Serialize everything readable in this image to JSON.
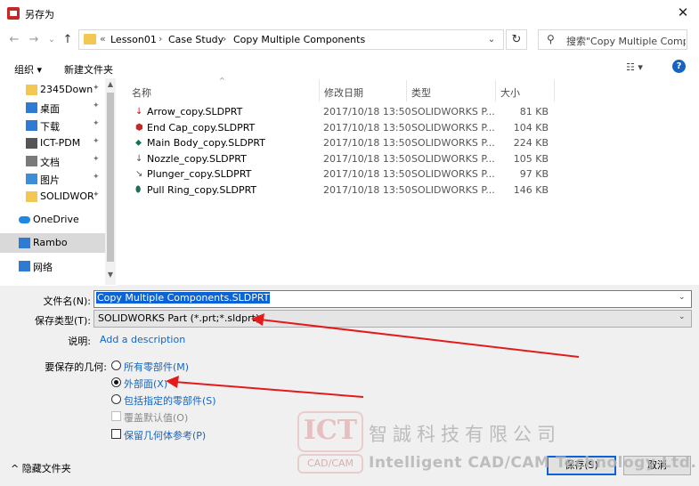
{
  "window": {
    "title": "另存为",
    "close": "✕"
  },
  "nav": {
    "back": "←",
    "forward": "→",
    "recent": "⌄",
    "up": "↑"
  },
  "address": {
    "overflow": "«",
    "crumbs": [
      "Lesson01",
      "Case Study",
      "Copy Multiple Components"
    ],
    "sep": "›",
    "dropdown": "⌄",
    "refresh": "↻"
  },
  "search": {
    "placeholder": "搜索\"Copy Multiple Comp..."
  },
  "toolbar": {
    "organize": "组织 ▾",
    "new_folder": "新建文件夹",
    "view": "☷ ▾",
    "help": "?"
  },
  "sidebar": {
    "items": [
      {
        "label": "2345Downlc",
        "icon": "folder-icon",
        "pinned": true
      },
      {
        "label": "桌面",
        "icon": "desktop-icon",
        "pinned": true
      },
      {
        "label": "下载",
        "icon": "download-icon",
        "pinned": true
      },
      {
        "label": "ICT-PDM",
        "icon": "network-drive-icon",
        "pinned": true
      },
      {
        "label": "文档",
        "icon": "document-icon",
        "pinned": true
      },
      {
        "label": "图片",
        "icon": "picture-icon",
        "pinned": true
      },
      {
        "label": "SOLIDWORI",
        "icon": "folder-icon",
        "pinned": true
      },
      {
        "label": "OneDrive",
        "icon": "cloud-icon",
        "pinned": false
      },
      {
        "label": "Rambo",
        "icon": "computer-icon",
        "pinned": false,
        "selected": true
      },
      {
        "label": "网络",
        "icon": "network-icon",
        "pinned": false
      }
    ],
    "pin_glyph": "📌"
  },
  "columns": {
    "name": "名称",
    "date": "修改日期",
    "type": "类型",
    "size": "大小",
    "sort": "^"
  },
  "files": [
    {
      "name": "Arrow_copy.SLDPRT",
      "date": "2017/10/18 13:50",
      "type": "SOLIDWORKS P...",
      "size": "81 KB",
      "icon": "↓",
      "color": "#b71c1c"
    },
    {
      "name": "End Cap_copy.SLDPRT",
      "date": "2017/10/18 13:50",
      "type": "SOLIDWORKS P...",
      "size": "104 KB",
      "icon": "⬢",
      "color": "#c62828"
    },
    {
      "name": "Main Body_copy.SLDPRT",
      "date": "2017/10/18 13:50",
      "type": "SOLIDWORKS P...",
      "size": "224 KB",
      "icon": "⬥",
      "color": "#1b6e5a"
    },
    {
      "name": "Nozzle_copy.SLDPRT",
      "date": "2017/10/18 13:50",
      "type": "SOLIDWORKS P...",
      "size": "105 KB",
      "icon": "↓",
      "color": "#555555"
    },
    {
      "name": "Plunger_copy.SLDPRT",
      "date": "2017/10/18 13:50",
      "type": "SOLIDWORKS P...",
      "size": "97 KB",
      "icon": "↘",
      "color": "#555555"
    },
    {
      "name": "Pull Ring_copy.SLDPRT",
      "date": "2017/10/18 13:50",
      "type": "SOLIDWORKS P...",
      "size": "146 KB",
      "icon": "⬮",
      "color": "#1b6e5a"
    }
  ],
  "form": {
    "filename_label": "文件名(N):",
    "filename_value": "Copy Multiple Components.SLDPRT",
    "filetype_label": "保存类型(T):",
    "filetype_value": "SOLIDWORKS Part (*.prt;*.sldprt)",
    "desc_label": "说明:",
    "desc_link": "Add a description",
    "geometry_label": "要保存的几何:",
    "options": [
      {
        "label": "所有零部件(M)",
        "checked": false
      },
      {
        "label": "外部面(X)",
        "checked": true
      },
      {
        "label": "包括指定的零部件(S)",
        "checked": false
      }
    ],
    "override_label": "覆盖默认值(O)",
    "keep_ref_label": "保留几何体参考(P)"
  },
  "footer": {
    "hide_folders": "^  隐藏文件夹",
    "save": "保存(S)",
    "cancel": "取消"
  },
  "watermark": {
    "logo": "ICT",
    "logo_sub": "CAD/CAM",
    "cn": "智誠科技有限公司",
    "en": "Intelligent CAD/CAM Technology Ltd."
  },
  "colors": {
    "accent": "#0a64d8",
    "link": "#1565c0",
    "arrow": "#e31b1b"
  }
}
